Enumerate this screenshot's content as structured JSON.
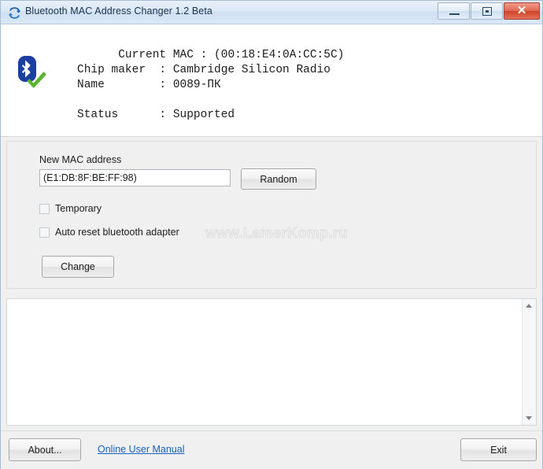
{
  "window": {
    "title": "Bluetooth MAC Address Changer 1.2 Beta",
    "app_icon": "bluetooth-refresh-icon",
    "controls": {
      "minimize": "minimize-icon",
      "maximize": "maximize-icon",
      "close": "✕"
    }
  },
  "info": {
    "icon": "bluetooth-supported-icon",
    "text": "Current MAC : (00:18:E4:0A:CC:5C)\nChip maker  : Cambridge Silicon Radio\nName        : 0089-ПК",
    "status_text": "Status      : Supported",
    "current_mac_label": "Current MAC",
    "current_mac_value": "(00:18:E4:0A:CC:5C)",
    "chip_maker_label": "Chip maker",
    "chip_maker_value": "Cambridge Silicon Radio",
    "name_label": "Name",
    "name_value": "0089-ПК",
    "status_label": "Status",
    "status_value": "Supported"
  },
  "form": {
    "new_mac_label": "New MAC address",
    "new_mac_value": "(E1:DB:8F:BE:FF:98)",
    "new_mac_placeholder": "",
    "random_label": "Random",
    "temporary_label": "Temporary",
    "temporary_checked": false,
    "auto_reset_label": "Auto reset bluetooth adapter",
    "auto_reset_checked": false,
    "change_label": "Change",
    "watermark": "www.LamerKomp.ru"
  },
  "log": {
    "value": "",
    "scrollbar": {
      "up_arrow": "arrow-up-icon",
      "down_arrow": "arrow-down-icon"
    }
  },
  "footer": {
    "about_label": "About...",
    "manual_link_label": "Online User Manual",
    "exit_label": "Exit"
  },
  "colors": {
    "title_accent": "#cfe0f2",
    "close_button": "#cf4428",
    "link": "#1560bd",
    "bluetooth_blue": "#1a3fa0",
    "check_green": "#5cb531",
    "panel_gray": "#f0f0f0"
  }
}
